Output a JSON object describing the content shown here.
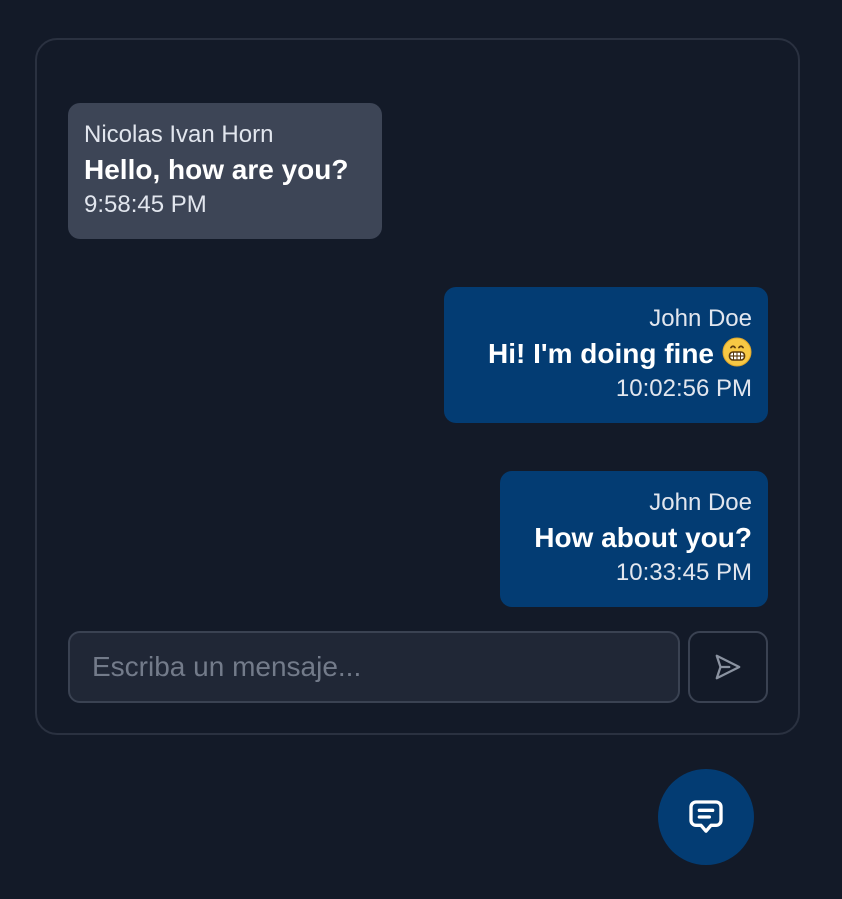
{
  "messages": [
    {
      "sender": "Nicolas Ivan Horn",
      "text": "Hello, how are you?",
      "time": "9:58:45 PM",
      "side": "received"
    },
    {
      "sender": "John Doe",
      "text": "Hi! I'm doing fine",
      "emoji": "grinning-face",
      "time": "10:02:56 PM",
      "side": "sent"
    },
    {
      "sender": "John Doe",
      "text": "How about you?",
      "time": "10:33:45 PM",
      "side": "sent"
    }
  ],
  "composer": {
    "placeholder": "Escriba un mensaje...",
    "value": "",
    "send_icon": "send-icon"
  },
  "fab": {
    "icon": "chat-icon"
  },
  "colors": {
    "background": "#131a28",
    "received_bubble": "#3d4556",
    "sent_bubble": "#033c73",
    "panel_border": "#2a3140"
  }
}
